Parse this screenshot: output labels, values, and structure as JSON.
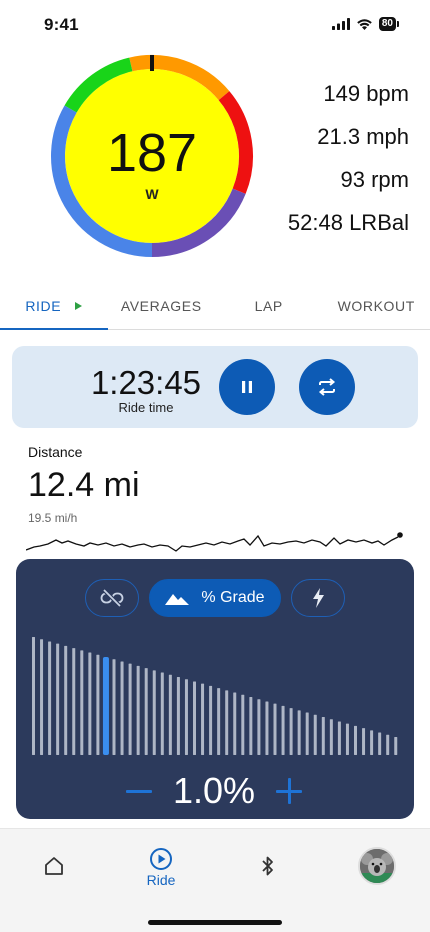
{
  "status_bar": {
    "time": "9:41",
    "battery": "80"
  },
  "gauge": {
    "value": "187",
    "unit": "W",
    "colors": {
      "green": "#19d419",
      "yellow": "#ffff00",
      "orange": "#ff9900",
      "red": "#ee1111",
      "purple": "#6a4fb5",
      "blue": "#4a84e8"
    }
  },
  "metrics": {
    "heart_rate": "149 bpm",
    "speed": "21.3 mph",
    "cadence": "93 rpm",
    "balance": "52:48 LRBal"
  },
  "tabs": [
    {
      "label": "RIDE",
      "active": true
    },
    {
      "label": "AVERAGES",
      "active": false
    },
    {
      "label": "LAP",
      "active": false
    },
    {
      "label": "WORKOUT",
      "active": false
    }
  ],
  "ride": {
    "time": "1:23:45",
    "label": "Ride time"
  },
  "distance": {
    "title": "Distance",
    "value": "12.4 mi",
    "sub": "19.5 mi/h"
  },
  "grade": {
    "mode_label": "% Grade",
    "value": "1.0%",
    "selected_bar": 9
  },
  "nav": {
    "ride_label": "Ride"
  },
  "colors": {
    "accent": "#0d5bb5",
    "panel": "#2c3a5c",
    "card": "#dde9f5"
  }
}
